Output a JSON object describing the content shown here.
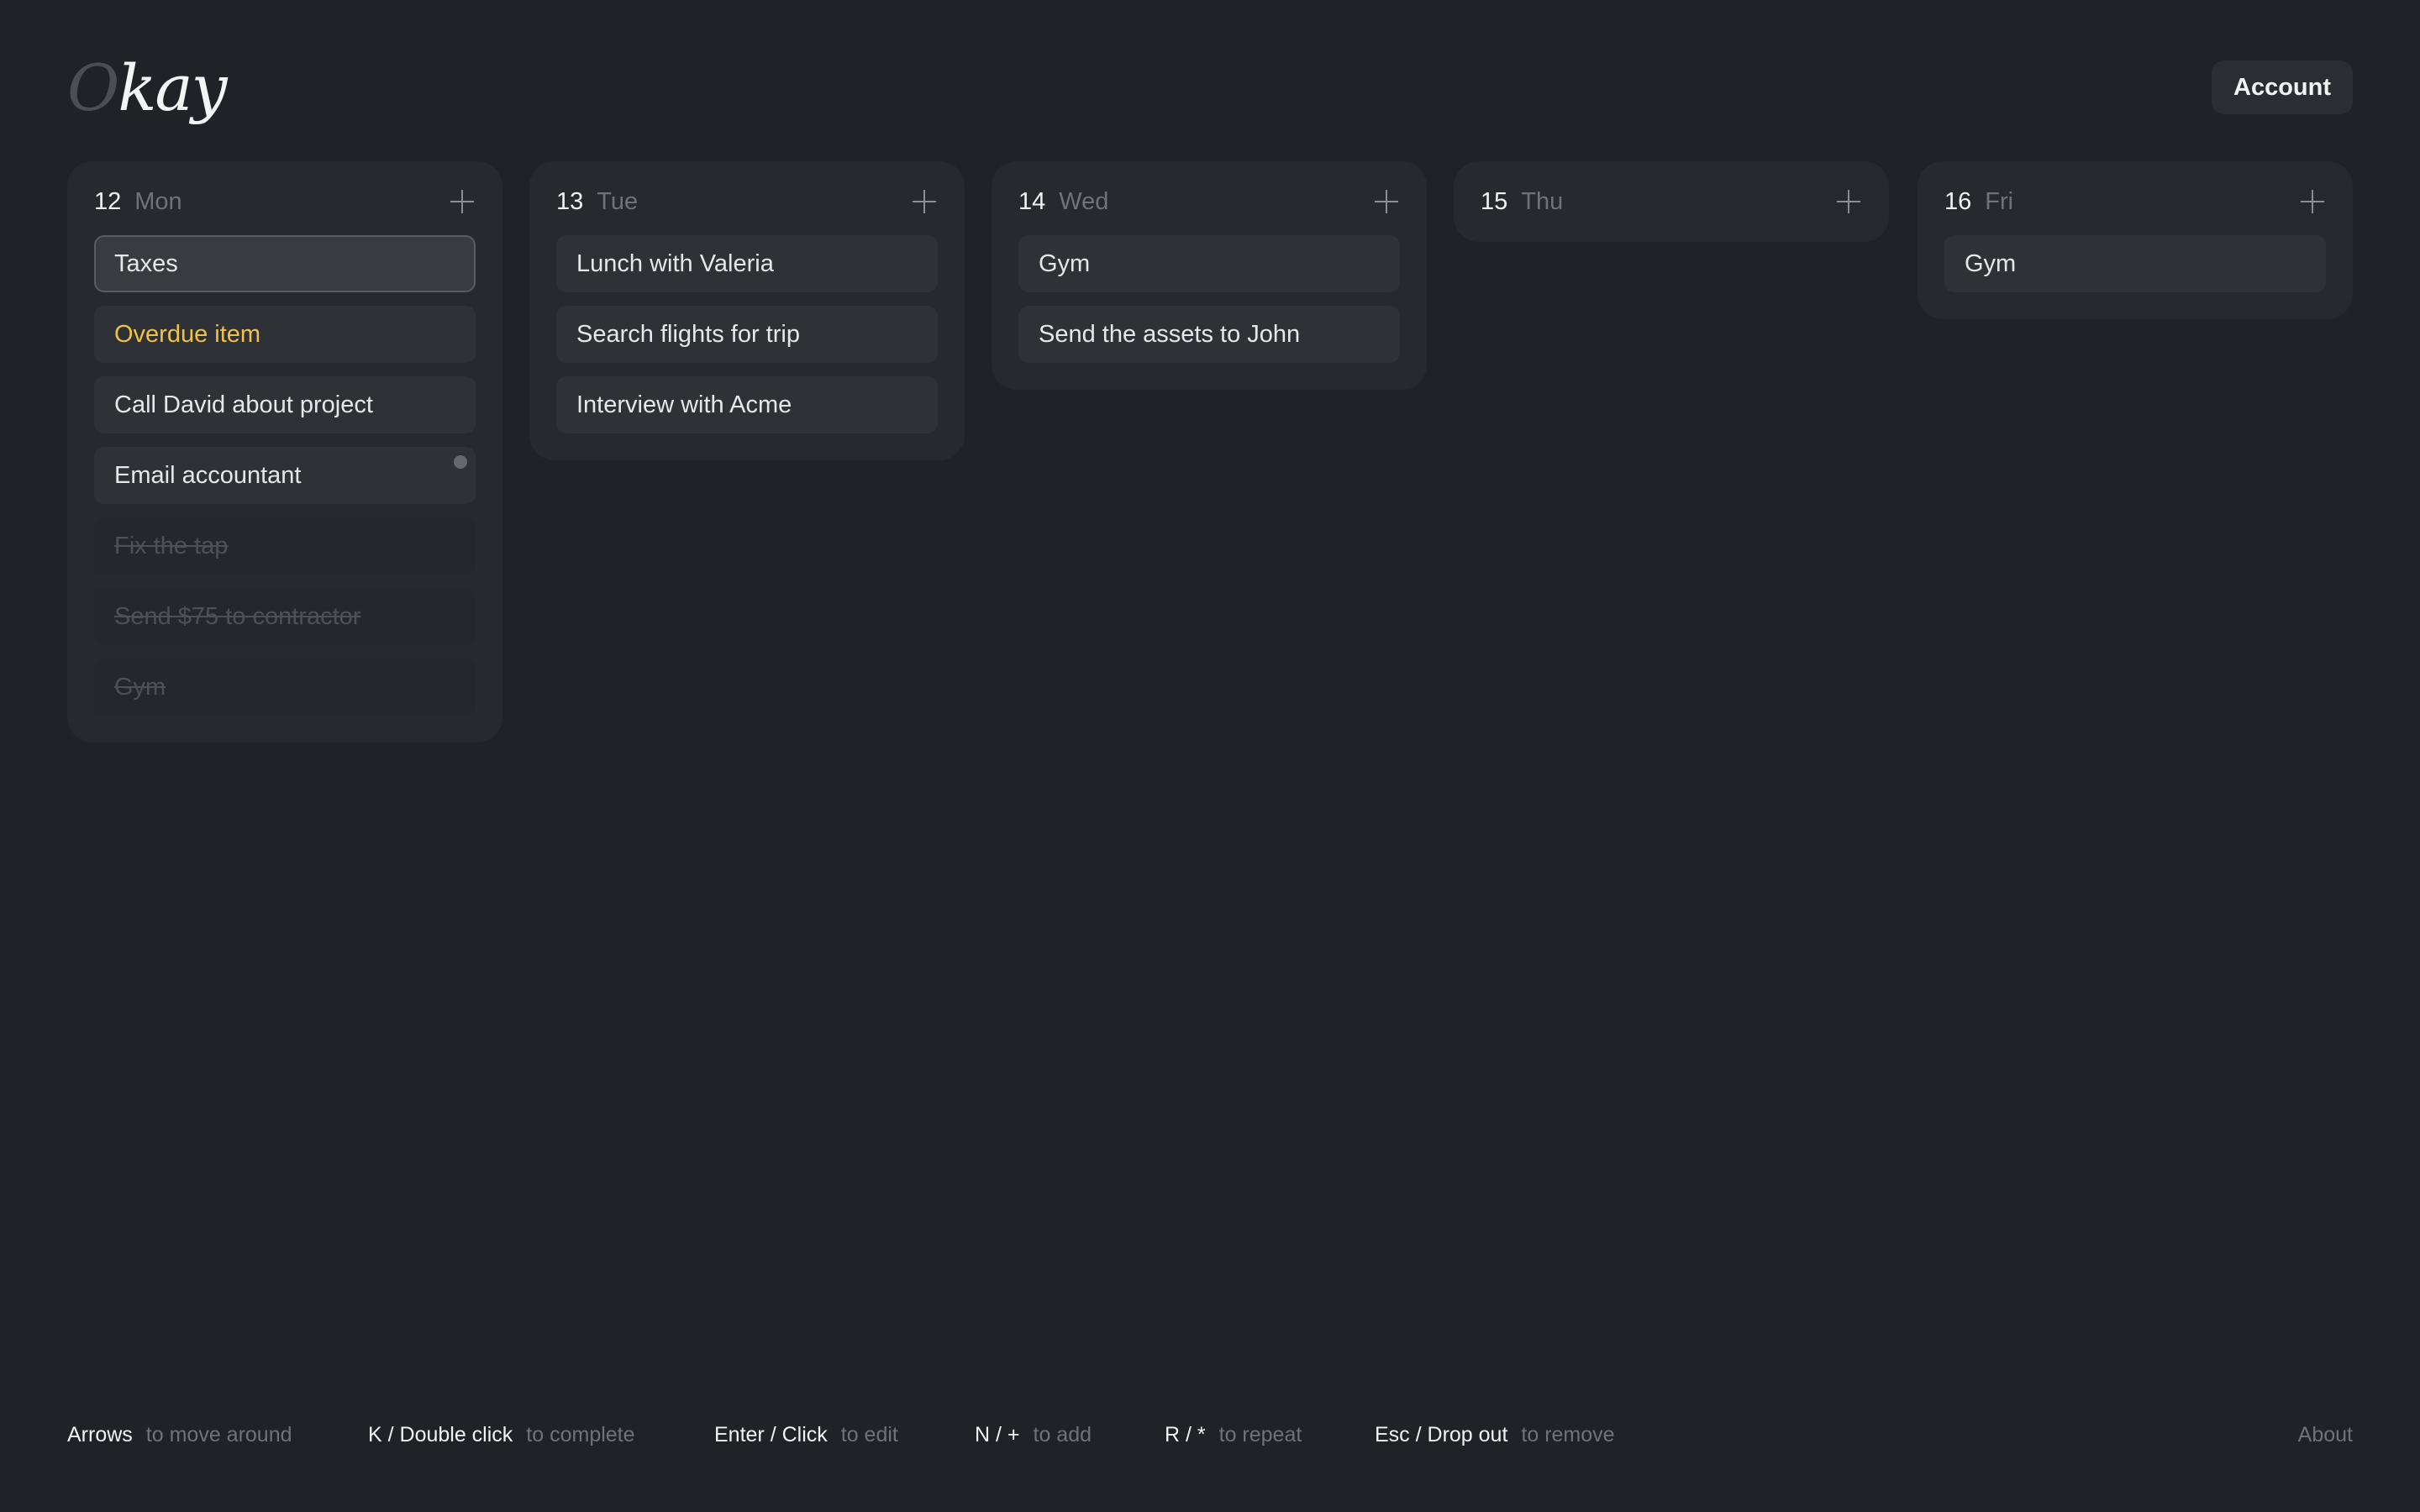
{
  "header": {
    "logo_first": "O",
    "logo_rest": "kay",
    "account_label": "Account"
  },
  "columns": [
    {
      "date": "12",
      "day": "Mon",
      "items": [
        {
          "text": "Taxes",
          "state": "selected"
        },
        {
          "text": "Overdue item",
          "state": "overdue"
        },
        {
          "text": "Call David about project",
          "state": "normal"
        },
        {
          "text": "Email accountant",
          "state": "repeat"
        },
        {
          "text": "Fix the tap",
          "state": "done"
        },
        {
          "text": "Send $75 to contractor",
          "state": "done"
        },
        {
          "text": "Gym",
          "state": "done"
        }
      ]
    },
    {
      "date": "13",
      "day": "Tue",
      "items": [
        {
          "text": "Lunch with Valeria",
          "state": "normal"
        },
        {
          "text": "Search flights for trip",
          "state": "normal"
        },
        {
          "text": "Interview with Acme",
          "state": "normal"
        }
      ]
    },
    {
      "date": "14",
      "day": "Wed",
      "items": [
        {
          "text": "Gym",
          "state": "normal"
        },
        {
          "text": "Send the assets to John",
          "state": "normal"
        }
      ]
    },
    {
      "date": "15",
      "day": "Thu",
      "items": []
    },
    {
      "date": "16",
      "day": "Fri",
      "items": [
        {
          "text": "Gym",
          "state": "normal"
        }
      ]
    }
  ],
  "footer": {
    "hints": [
      {
        "key": "Arrows",
        "desc": "to move around"
      },
      {
        "key": "K / Double click",
        "desc": "to complete"
      },
      {
        "key": "Enter / Click",
        "desc": "to edit"
      },
      {
        "key": "N / +",
        "desc": "to add"
      },
      {
        "key": "R / *",
        "desc": "to repeat"
      },
      {
        "key": "Esc / Drop out",
        "desc": "to remove"
      }
    ],
    "about_label": "About"
  },
  "colors": {
    "background": "#1f2327",
    "column": "#262a2e",
    "item": "#2e3236",
    "overdue": "#f0c04c",
    "muted_text": "#6e7378"
  }
}
